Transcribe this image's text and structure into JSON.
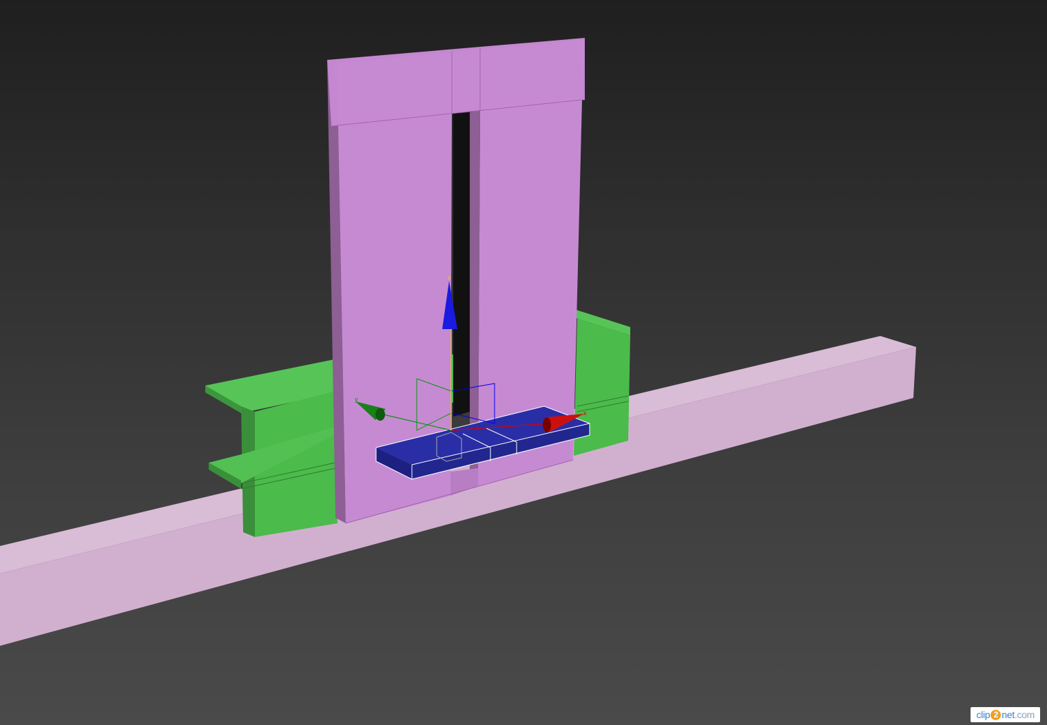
{
  "viewport": {
    "background_top": "#1f1f1f",
    "background_bottom": "#4a4a4a"
  },
  "objects": {
    "beam": {
      "color": "#d4b3d1"
    },
    "green_block": {
      "color": "#4bbb4b"
    },
    "pink_frame": {
      "color": "#c78ad2"
    },
    "blue_slab": {
      "color": "#2a2ea0"
    }
  },
  "gizmo": {
    "x_label": "x",
    "y_label": "y",
    "z_label": "z",
    "x_color": "#dd0000",
    "y_color": "#009900",
    "z_color": "#0000ee"
  },
  "watermark": {
    "part1": "clip",
    "part2": "2",
    "part3": "net",
    "part4": ".com"
  }
}
